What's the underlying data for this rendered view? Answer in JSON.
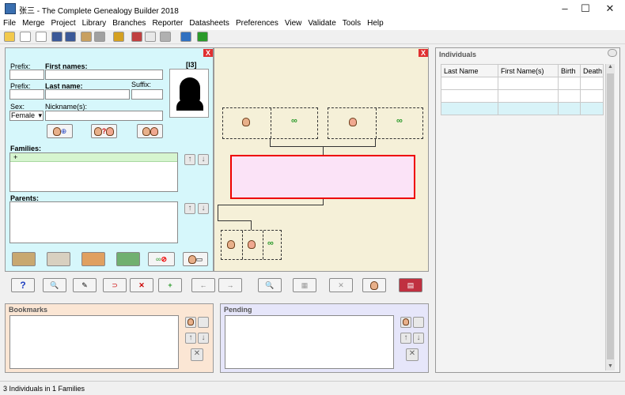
{
  "window": {
    "title": "张三 - The Complete Genealogy Builder 2018",
    "minimize": "–",
    "maximize": "☐",
    "close": "✕"
  },
  "menu": [
    "File",
    "Merge",
    "Project",
    "Library",
    "Branches",
    "Reporter",
    "Datasheets",
    "Preferences",
    "View",
    "Validate",
    "Tools",
    "Help"
  ],
  "editor": {
    "record_id": "[I3]",
    "prefix_label": "Prefix:",
    "first_names_label": "First names:",
    "last_name_label": "Last name:",
    "suffix_label": "Suffix:",
    "sex_label": "Sex:",
    "sex_value": "Female",
    "nickname_label": "Nickname(s):",
    "families_label": "Families:",
    "families_item": "+",
    "parents_label": "Parents:",
    "close_label": "X"
  },
  "tree": {
    "close_label": "X"
  },
  "individuals": {
    "title": "Individuals",
    "columns": [
      "Last Name",
      "First Name(s)",
      "Birth",
      "Death"
    ],
    "rows": 3
  },
  "bookmarks": {
    "title": "Bookmarks"
  },
  "pending": {
    "title": "Pending"
  },
  "status": {
    "text": "3 Individuals in 1 Families"
  },
  "colors": {
    "selected_box": "#ff0000",
    "selected_fill": "#fbe3f7",
    "editor_bg": "#d6f7fb",
    "tree_bg": "#f5f0d8"
  }
}
